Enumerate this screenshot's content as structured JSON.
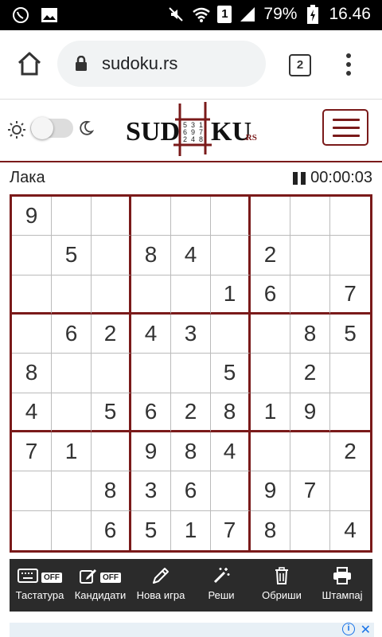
{
  "status_bar": {
    "battery": "79%",
    "time": "16.46",
    "sim_badge": "1",
    "left_icons": [
      "viber-icon",
      "image-icon"
    ],
    "right_icons": [
      "mute-icon",
      "wifi-icon",
      "sim-icon",
      "signal-icon",
      "battery-icon"
    ]
  },
  "browser": {
    "url": "sudoku.rs",
    "tab_count": "2"
  },
  "site": {
    "logo_text_left": "SUD",
    "logo_text_right": "KU",
    "logo_suffix": ".RS",
    "logo_grid": [
      "5",
      "3",
      "1",
      "6",
      "9",
      "7",
      "2",
      "4",
      "8"
    ]
  },
  "game": {
    "difficulty": "Лака",
    "timer": "00:00:03",
    "board": [
      [
        "9",
        "",
        "",
        "",
        "",
        "",
        "",
        "",
        ""
      ],
      [
        "",
        "5",
        "",
        "8",
        "4",
        "",
        "2",
        "",
        ""
      ],
      [
        "",
        "",
        "",
        "",
        "",
        "1",
        "6",
        "",
        "7"
      ],
      [
        "",
        "6",
        "2",
        "4",
        "3",
        "",
        "",
        "8",
        "5"
      ],
      [
        "8",
        "",
        "",
        "",
        "",
        "5",
        "",
        "2",
        ""
      ],
      [
        "4",
        "",
        "5",
        "6",
        "2",
        "8",
        "1",
        "9",
        ""
      ],
      [
        "7",
        "1",
        "",
        "9",
        "8",
        "4",
        "",
        "",
        "2"
      ],
      [
        "",
        "",
        "8",
        "3",
        "6",
        "",
        "9",
        "7",
        ""
      ],
      [
        "",
        "",
        "6",
        "5",
        "1",
        "7",
        "8",
        "",
        "4"
      ]
    ]
  },
  "toolbar": {
    "keyboard_label": "Тастатура",
    "keyboard_state": "OFF",
    "candidates_label": "Кандидати",
    "candidates_state": "OFF",
    "new_game_label": "Нова игра",
    "solve_label": "Реши",
    "clear_label": "Обриши",
    "print_label": "Штампај"
  },
  "colors": {
    "accent": "#7a1a1a",
    "toolbar_bg": "#2b2b2b"
  }
}
